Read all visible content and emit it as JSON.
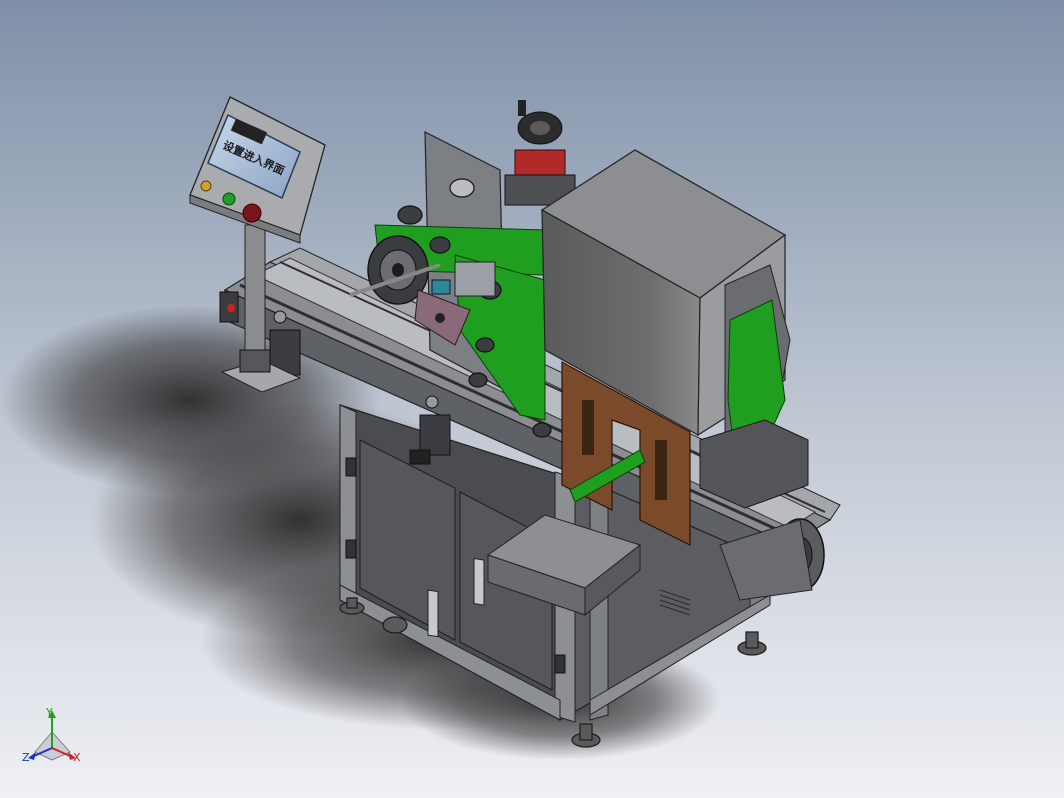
{
  "viewport": {
    "background_top": "#7e90a8",
    "background_bottom": "#eef0f4"
  },
  "machine": {
    "frame_color": "#5c5f63",
    "panel_color": "#4b4d50",
    "accent_green": "#1f9e1f",
    "bronze_plate": "#7a4a2a",
    "label_roll_red": "#b02a2a",
    "hmi": {
      "screen_text": "设置进入界面",
      "brand_text": "████",
      "buttons": [
        "yellow-lamp",
        "green-button",
        "red-button"
      ]
    }
  },
  "triad": {
    "x_label": "X",
    "y_label": "Y",
    "z_label": "Z",
    "x_color": "#d0202a",
    "y_color": "#20a020",
    "z_color": "#2030c0"
  }
}
